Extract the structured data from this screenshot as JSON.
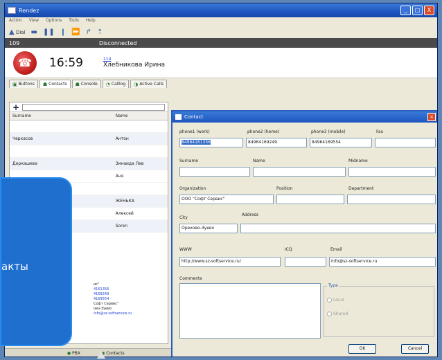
{
  "window": {
    "title": "Rendez",
    "min": "_",
    "max": "□",
    "close": "X"
  },
  "menu": [
    "Action",
    "View",
    "Options",
    "Tools",
    "Help"
  ],
  "toolbar": {
    "dial_label": "Dial"
  },
  "status": {
    "extension": "109",
    "state": "Disconnected"
  },
  "call": {
    "time": "16:59",
    "number": "114",
    "name": "Хлебникова Ирина"
  },
  "tabs": [
    {
      "label": "Buttons"
    },
    {
      "label": "Contacts"
    },
    {
      "label": "Console"
    },
    {
      "label": "Calllog"
    },
    {
      "label": "Active Calls"
    }
  ],
  "contacts": {
    "add": "+",
    "columns": [
      "Surname",
      "Name"
    ],
    "rows": [
      {
        "surname": "Черкасов",
        "name": "Антон"
      },
      {
        "surname": "Деркашева",
        "name": "Зинаида Лев"
      },
      {
        "surname": "",
        "name": "Аня"
      },
      {
        "surname": "",
        "name": "ЖЕНЬКА"
      },
      {
        "surname": "",
        "name": "Алексей"
      },
      {
        "surname": "",
        "name": "Soren"
      }
    ],
    "detail": {
      "company": "ис\"",
      "p1": "4161356",
      "p2": "4169249",
      "p3": "4169554",
      "org": "Софт Сервис\"",
      "city": "ово-Зуево",
      "mail": "info@sz-softservice.ru"
    }
  },
  "bottom_status": [
    "PBX",
    "Contacts"
  ],
  "dialog": {
    "title": "Contact",
    "labels": {
      "phone1": "phone1 (work)",
      "phone2": "phone2 (home)",
      "phone3": "phone3 (mobile)",
      "fax": "Fax",
      "surname": "Surname",
      "name": "Name",
      "midname": "Midname",
      "organization": "Organization",
      "position": "Position",
      "department": "Department",
      "city": "City",
      "address": "Address",
      "www": "WWW",
      "icq": "ICQ",
      "email": "Email",
      "comments": "Comments",
      "type": "Type"
    },
    "values": {
      "phone1": "84964161356",
      "phone2": "84964169249",
      "phone3": "84964169554",
      "fax": "",
      "surname": "",
      "name": "",
      "midname": "",
      "organization": "ООО \"Софт Сервис\"",
      "position": "",
      "department": "",
      "city": "Орехово-Зуево",
      "address": "",
      "www": "http://www.sz-softservice.ru/",
      "icq": "",
      "email": "info@sz-softservice.ru"
    },
    "type_options": [
      "Local",
      "Shared"
    ],
    "ok": "OK",
    "cancel": "Cancel"
  },
  "overlay": {
    "text": "акты"
  }
}
